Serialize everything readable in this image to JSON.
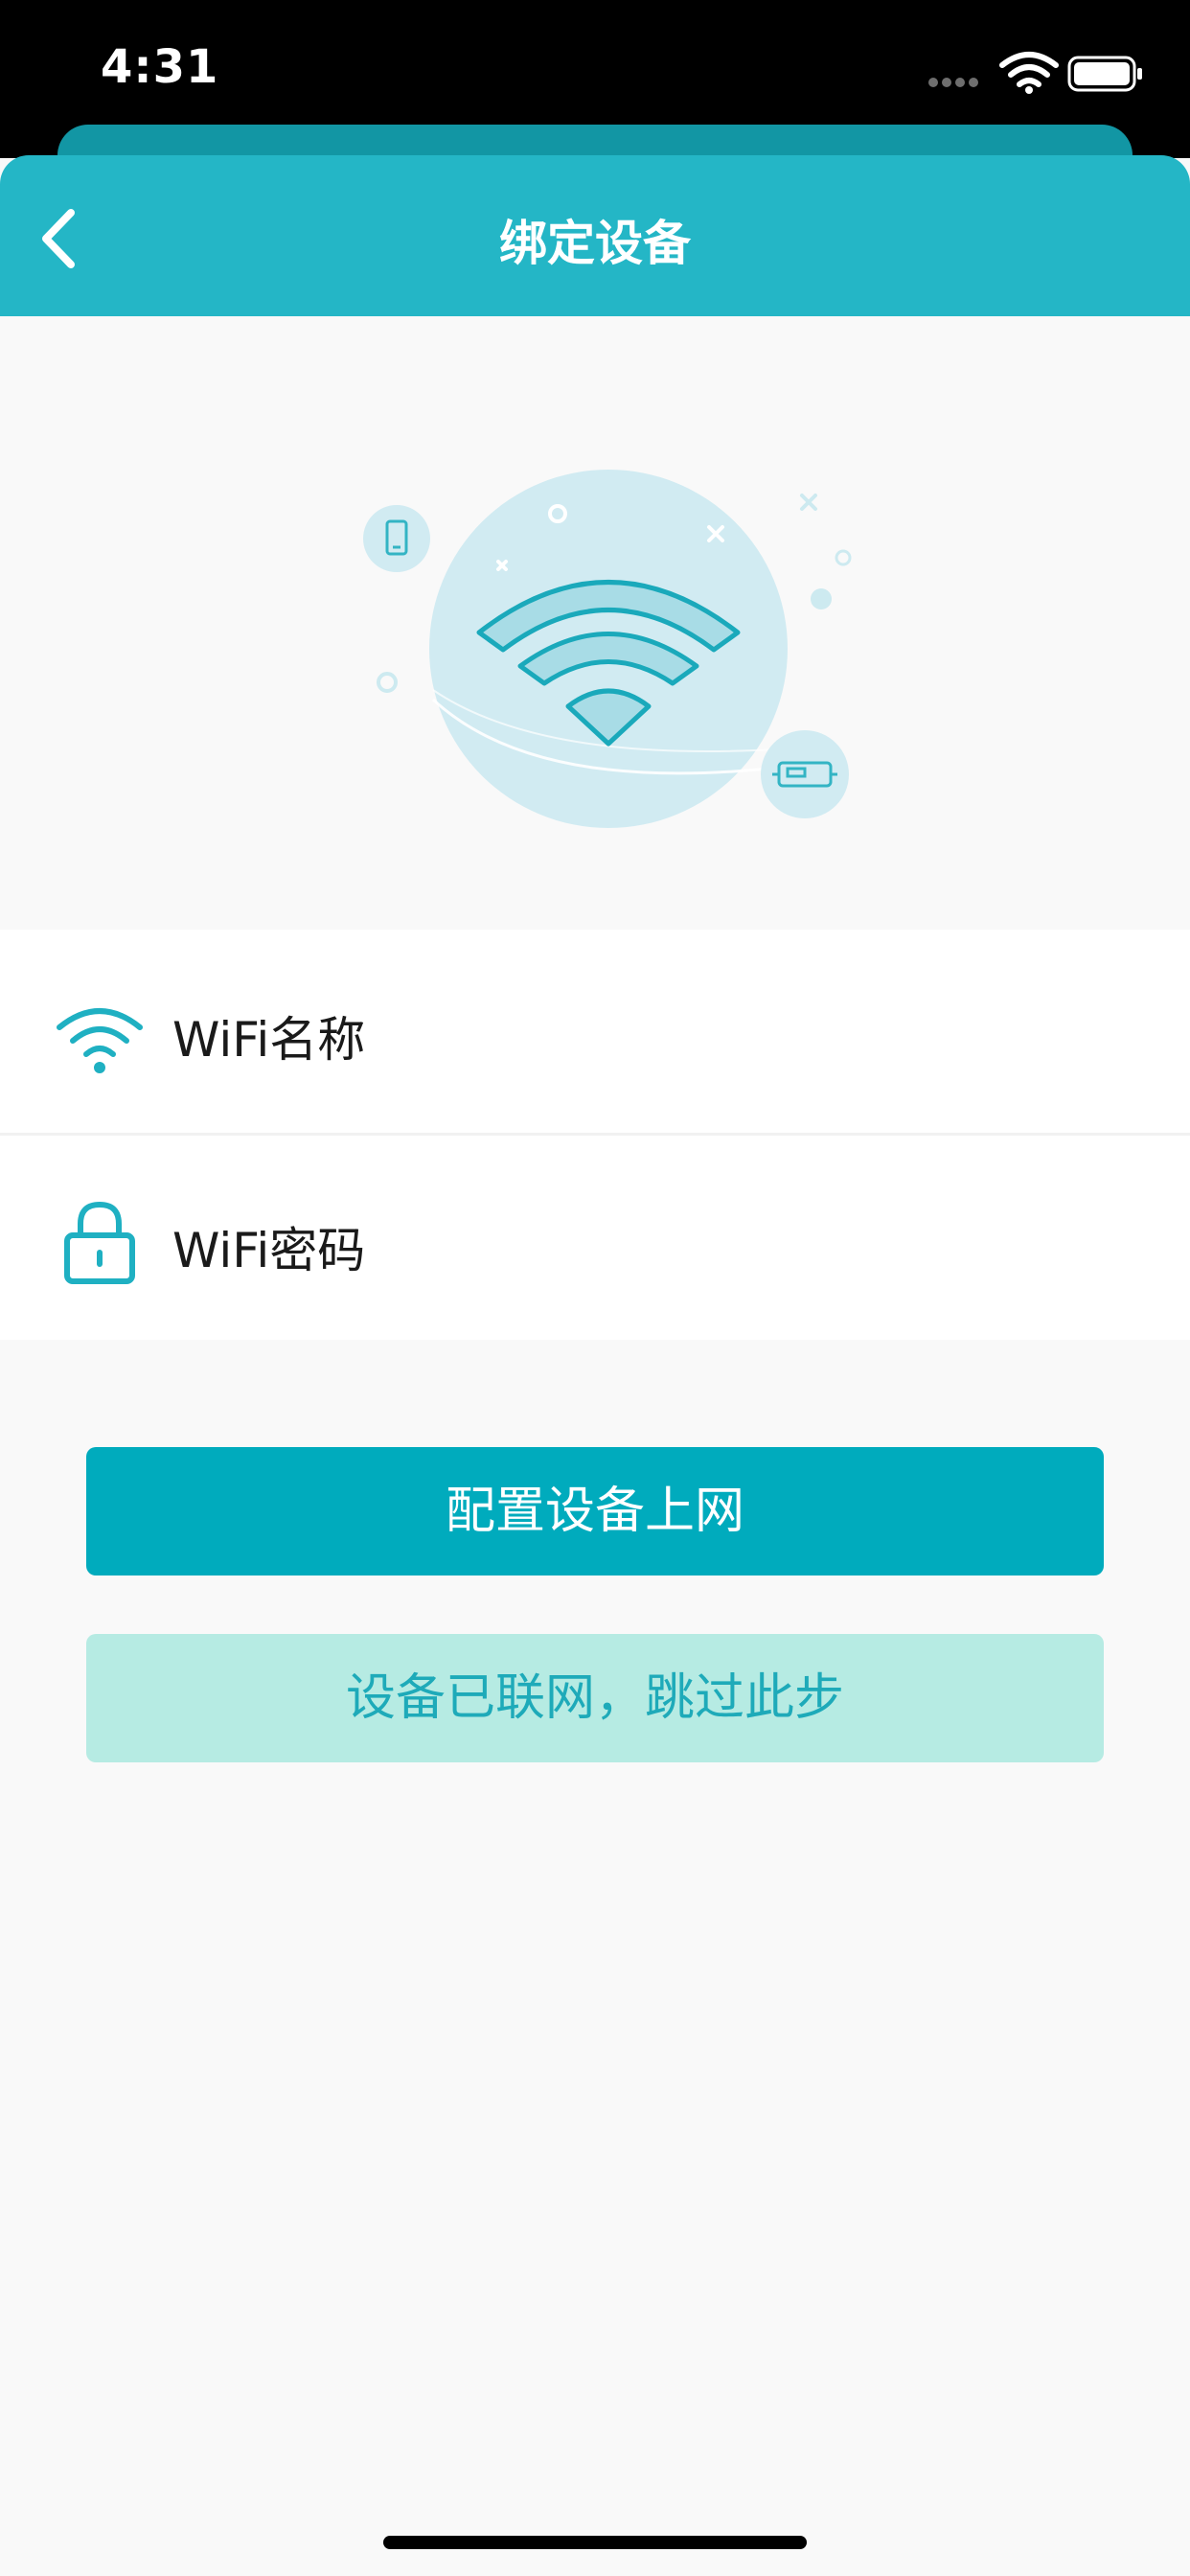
{
  "status_bar": {
    "time": "4:31"
  },
  "nav": {
    "title": "绑定设备",
    "back_icon": "chevron-left-icon"
  },
  "form": {
    "ssid_label": "WiFi名称",
    "ssid_icon": "wifi-icon",
    "password_label": "WiFi密码",
    "password_icon": "lock-icon"
  },
  "actions": {
    "configure_label": "配置设备上网",
    "skip_label": "设备已联网，跳过此步"
  },
  "colors": {
    "accent": "#24b6c6",
    "primary_button": "#00abbd",
    "secondary_button": "#b6ebe3",
    "secondary_text": "#1eaab9",
    "background": "#f9f9f9"
  }
}
